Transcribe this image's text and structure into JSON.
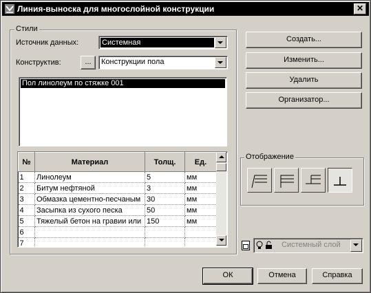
{
  "window": {
    "title": "Линия-выноска для многослойной конструкции",
    "close_glyph": "✕"
  },
  "styles_group": {
    "label": "Стили",
    "data_source_label": "Источник данных:",
    "data_source_value": "Системная",
    "construct_label": "Конструктив:",
    "browse_label": "...",
    "construct_value": "Конструкции пола",
    "list_items": [
      "Пол линолеум по стяжке 001"
    ]
  },
  "table": {
    "headers": [
      "№",
      "Материал",
      "Толщ.",
      "Ед."
    ],
    "rows": [
      [
        "1",
        "Линолеум",
        "5",
        "мм"
      ],
      [
        "2",
        "Битум нефтяной",
        "3",
        "мм"
      ],
      [
        "3",
        "Обмазка цементно-песчаным",
        "30",
        "мм"
      ],
      [
        "4",
        "Засыпка из сухого песка",
        "50",
        "мм"
      ],
      [
        "5",
        "Тяжелый бетон на гравии или",
        "150",
        "мм"
      ],
      [
        "6",
        "",
        "",
        ""
      ],
      [
        "7",
        "",
        "",
        ""
      ]
    ]
  },
  "actions": {
    "create": "Создать...",
    "edit": "Изменить...",
    "delete": "Удалить",
    "organizer": "Организатор..."
  },
  "display_group": {
    "label": "Отображение",
    "modes": [
      "leader-bent-left",
      "leader-bent-right",
      "leader-straight",
      "leader-perpendicular"
    ],
    "selected_mode": 4
  },
  "layer": {
    "value": "Системный слой",
    "icons": [
      "layer-sheet-icon",
      "bulb-icon",
      "lock-icon"
    ]
  },
  "footer": {
    "ok": "ОК",
    "cancel": "Отмена",
    "help": "Справка"
  }
}
